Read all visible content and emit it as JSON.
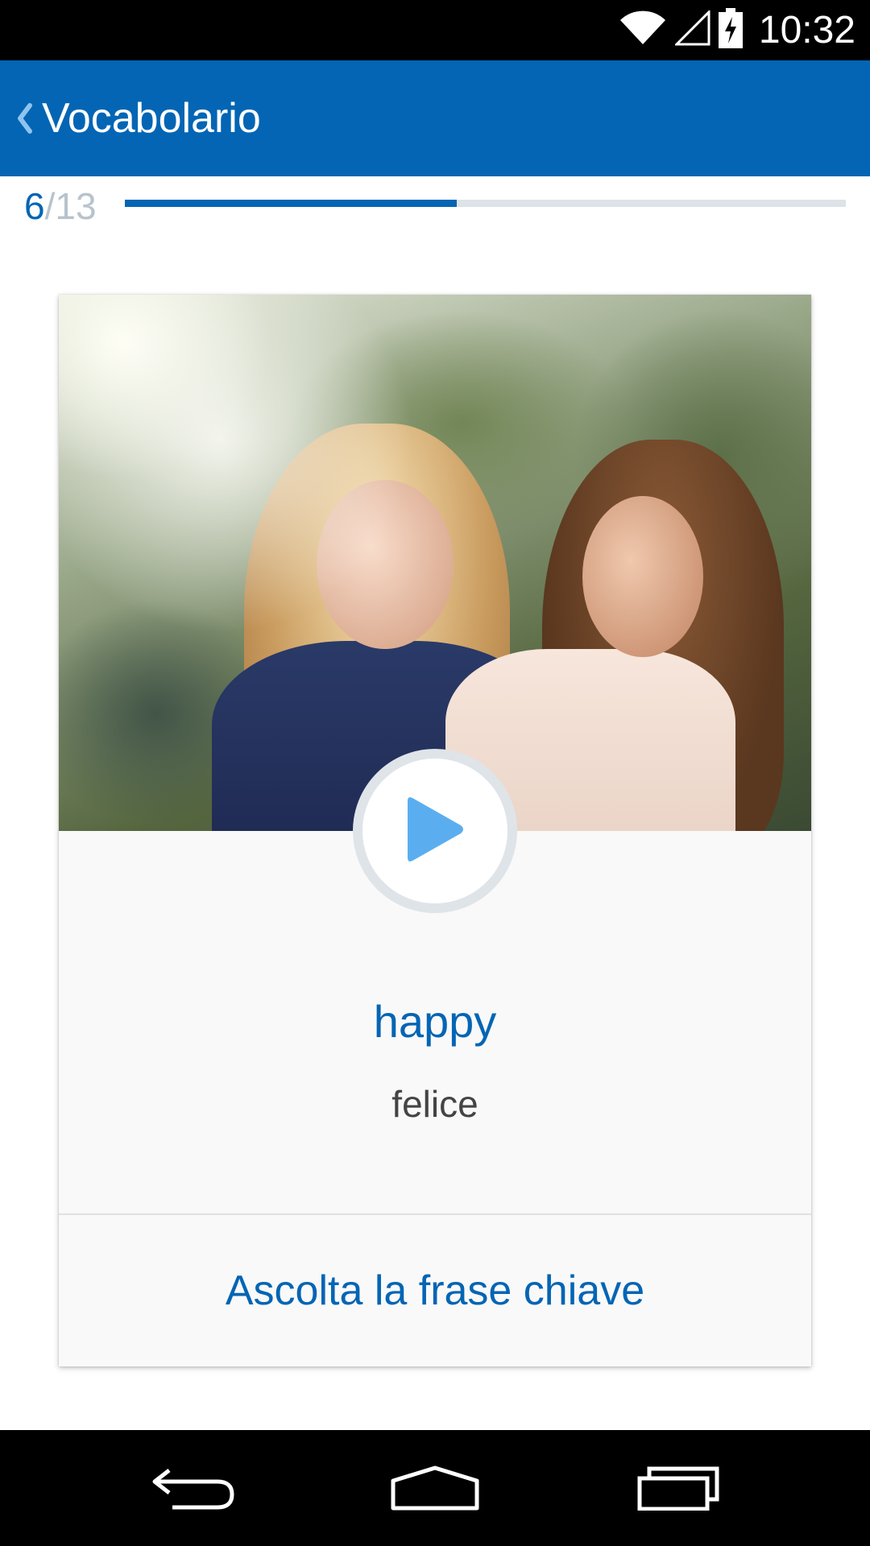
{
  "status_bar": {
    "time": "10:32",
    "icons": [
      "wifi-icon",
      "cell-signal-icon",
      "battery-charging-icon"
    ]
  },
  "app_bar": {
    "title": "Vocabolario",
    "back_icon": "chevron-left-icon",
    "background_color": "#0365b4"
  },
  "progress": {
    "current": "6",
    "separator": "/",
    "total": "13",
    "fraction": 0.46
  },
  "card": {
    "image_icon": "photo-two-women-laughing",
    "play_icon": "play-icon",
    "word": "happy",
    "translation": "felice",
    "key_phrase_label": "Ascolta la frase chiave"
  },
  "nav_bar": {
    "icons": [
      "back-icon",
      "home-icon",
      "recent-apps-icon"
    ]
  },
  "colors": {
    "accent": "#0365b4",
    "play_triangle": "#5aaeef",
    "card_background": "#f9f9f9"
  }
}
